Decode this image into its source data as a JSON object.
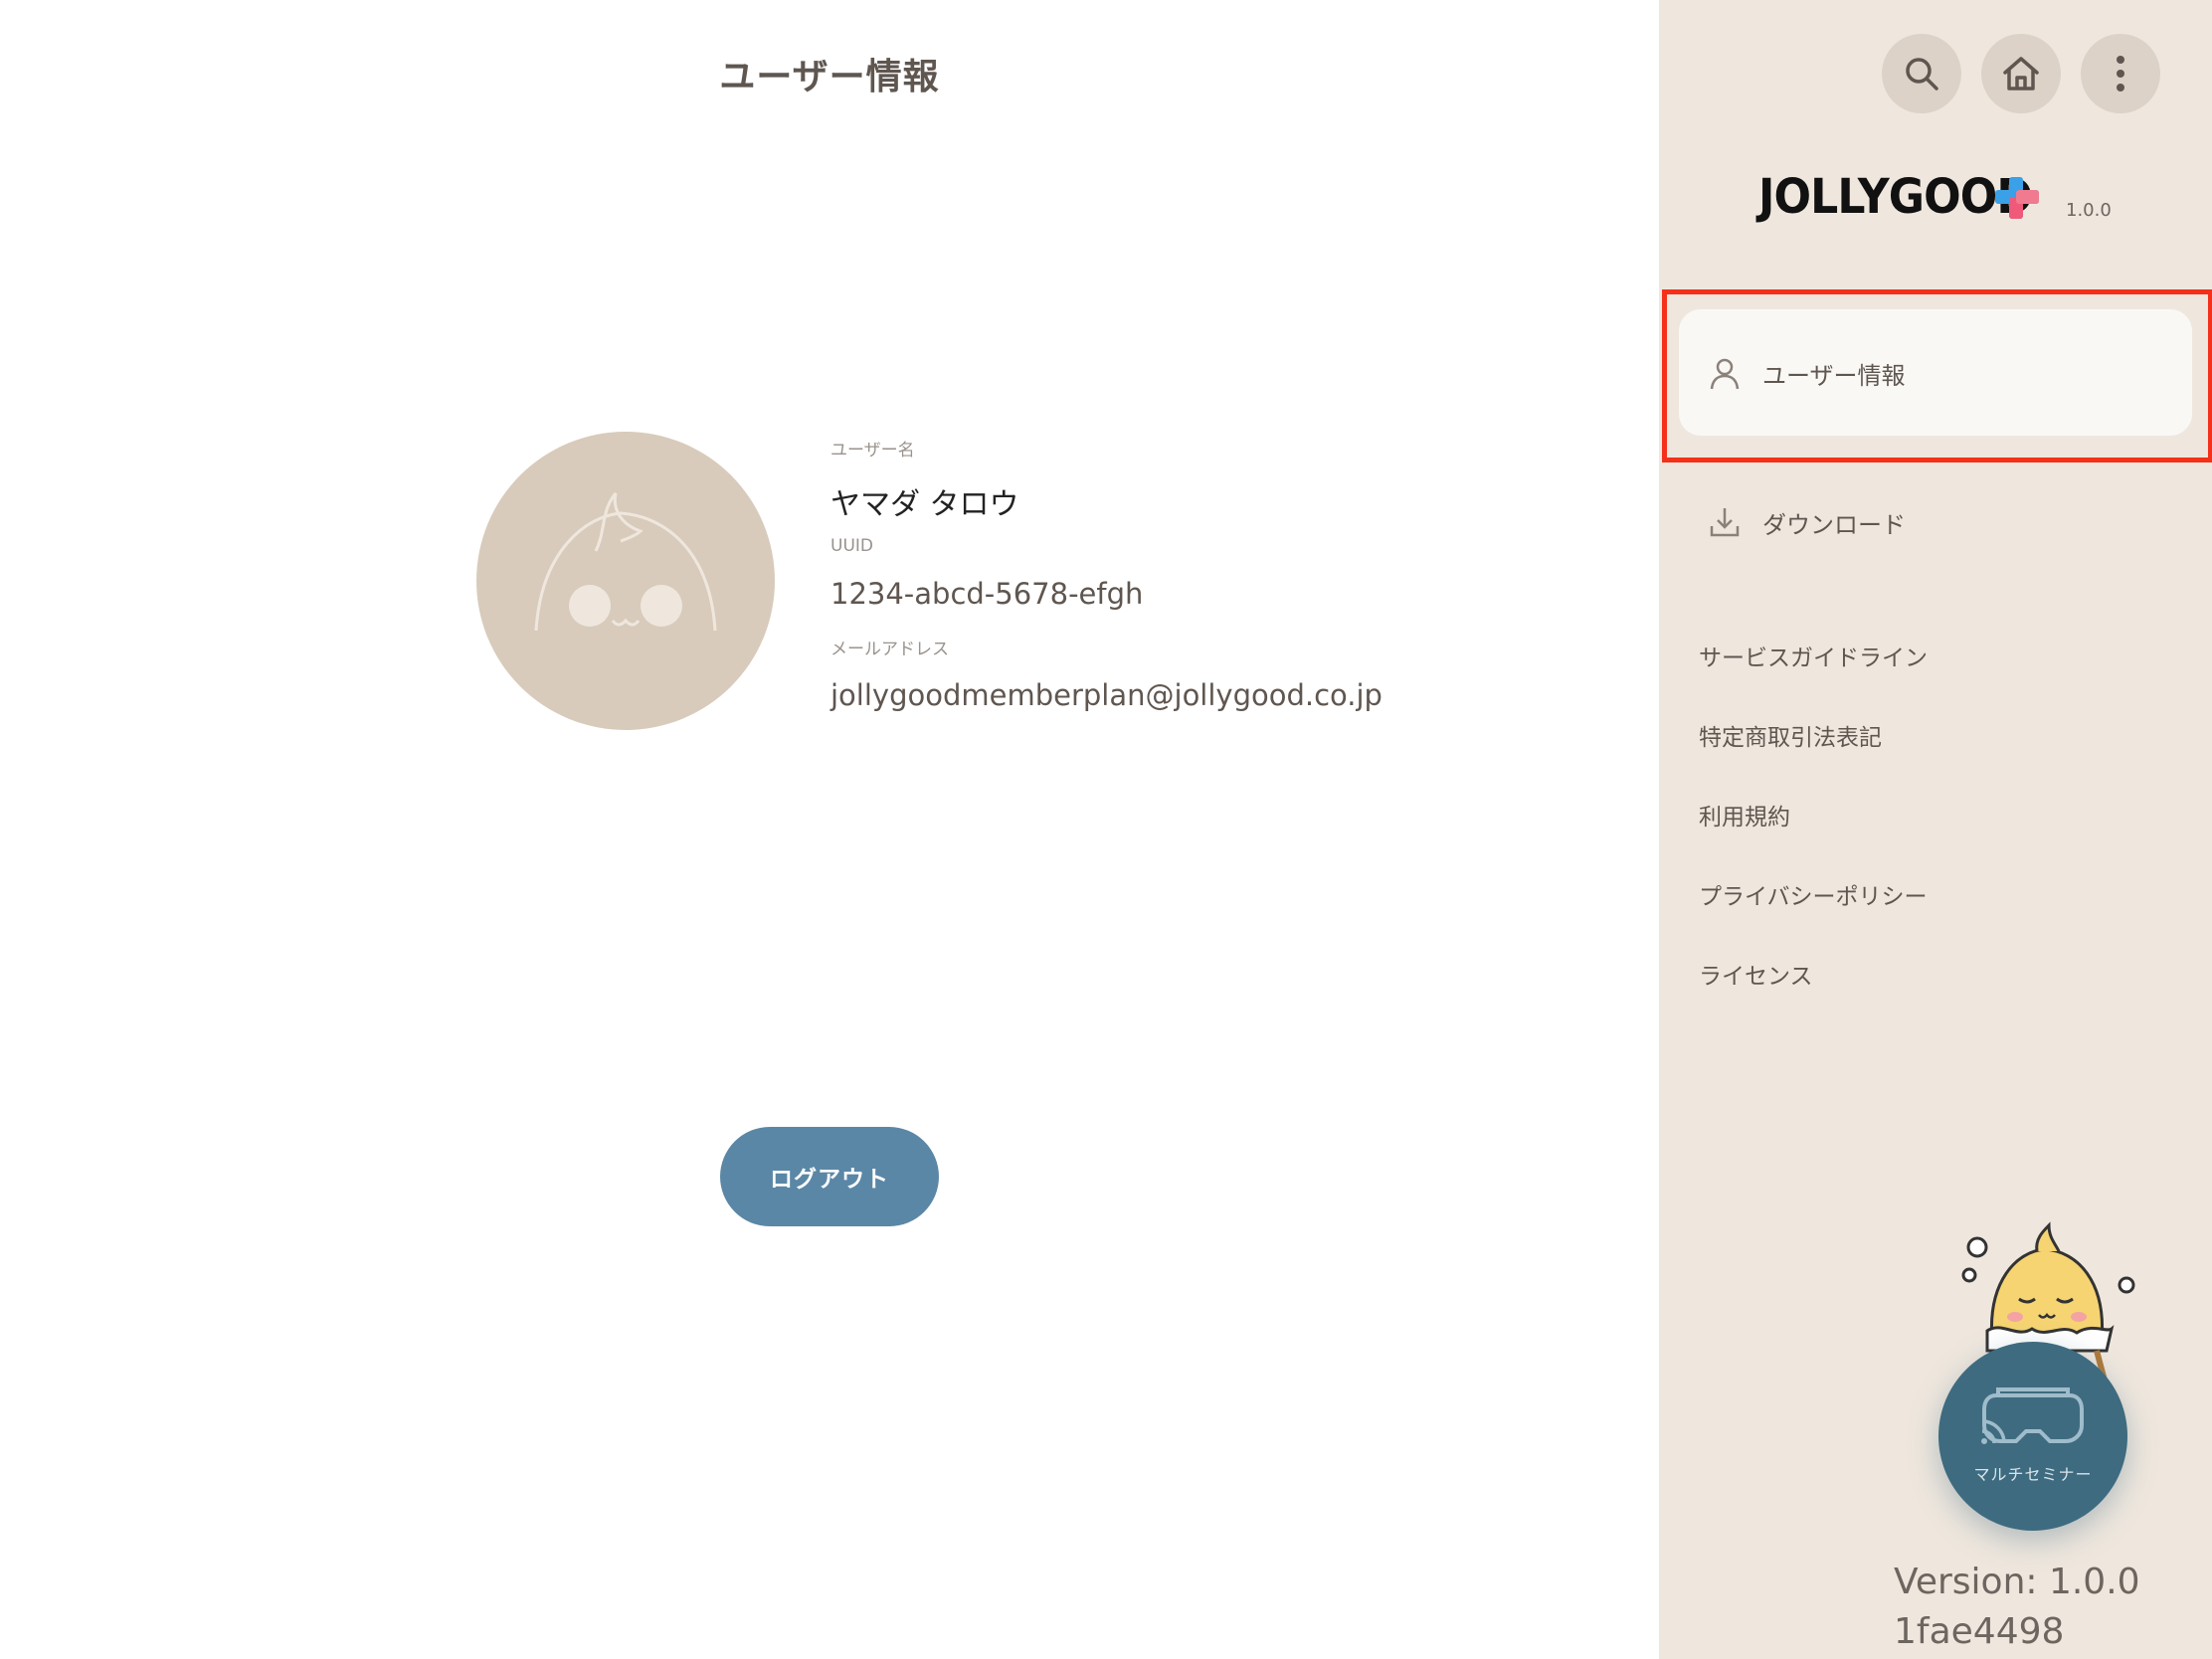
{
  "main": {
    "title": "ユーザー情報",
    "user": {
      "name_label": "ユーザー名",
      "name": "ヤマダ タロウ",
      "uuid_label": "UUID",
      "uuid": "1234-abcd-5678-efgh",
      "email_label": "メールアドレス",
      "email": "jollygoodmemberplan@jollygood.co.jp"
    },
    "logout_label": "ログアウト"
  },
  "sidebar": {
    "top_buttons": [
      "search-icon",
      "home-icon",
      "more-vertical-icon"
    ],
    "logo_text": "JOLLYGOOD",
    "app_version": "1.0.0",
    "nav": [
      {
        "label": "ユーザー情報",
        "icon": "user-icon",
        "selected": true
      },
      {
        "label": "ダウンロード",
        "icon": "download-icon",
        "selected": false
      }
    ],
    "links": [
      "サービスガイドライン",
      "特定商取引法表記",
      "利用規約",
      "プライバシーポリシー",
      "ライセンス"
    ],
    "fab_label": "マルチセミナー",
    "version_text": "Version: 1.0.0",
    "build_hash": "1fae4498"
  },
  "colors": {
    "sidebar_bg": "#efe7de",
    "accent_button": "#5b87a6",
    "fab": "#3e6b80",
    "highlight": "#f5301a",
    "avatar_bg": "#d8cbbb"
  }
}
